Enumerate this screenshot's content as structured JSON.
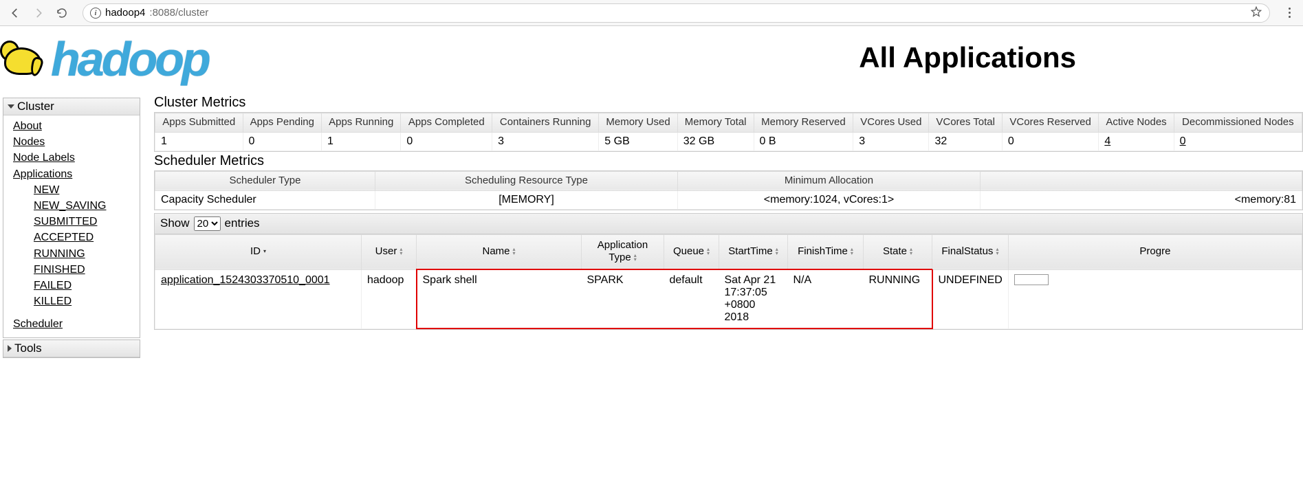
{
  "browser": {
    "url_host": "hadoop4",
    "url_rest": ":8088/cluster"
  },
  "header": {
    "logo_text": "hadoop",
    "page_title": "All Applications"
  },
  "sidebar": {
    "cluster_label": "Cluster",
    "tools_label": "Tools",
    "links": {
      "about": "About",
      "nodes": "Nodes",
      "node_labels": "Node Labels",
      "applications": "Applications",
      "scheduler": "Scheduler"
    },
    "app_states": [
      "NEW",
      "NEW_SAVING",
      "SUBMITTED",
      "ACCEPTED",
      "RUNNING",
      "FINISHED",
      "FAILED",
      "KILLED"
    ]
  },
  "cluster_metrics": {
    "section_title": "Cluster Metrics",
    "headers": [
      "Apps Submitted",
      "Apps Pending",
      "Apps Running",
      "Apps Completed",
      "Containers Running",
      "Memory Used",
      "Memory Total",
      "Memory Reserved",
      "VCores Used",
      "VCores Total",
      "VCores Reserved",
      "Active Nodes",
      "Decommissioned Nodes"
    ],
    "values": [
      "1",
      "0",
      "1",
      "0",
      "3",
      "5 GB",
      "32 GB",
      "0 B",
      "3",
      "32",
      "0",
      "4",
      "0"
    ]
  },
  "scheduler_metrics": {
    "section_title": "Scheduler Metrics",
    "headers": [
      "Scheduler Type",
      "Scheduling Resource Type",
      "Minimum Allocation",
      ""
    ],
    "values": [
      "Capacity Scheduler",
      "[MEMORY]",
      "<memory:1024, vCores:1>",
      "<memory:81"
    ]
  },
  "show_entries": {
    "prefix": "Show",
    "value": "20",
    "suffix": "entries"
  },
  "apps_table": {
    "headers": [
      "ID",
      "User",
      "Name",
      "Application Type",
      "Queue",
      "StartTime",
      "FinishTime",
      "State",
      "FinalStatus",
      "Progre"
    ],
    "rows": [
      {
        "id": "application_1524303370510_0001",
        "user": "hadoop",
        "name": "Spark shell",
        "app_type": "SPARK",
        "queue": "default",
        "start_time": "Sat Apr 21 17:37:05 +0800 2018",
        "finish_time": "N/A",
        "state": "RUNNING",
        "final_status": "UNDEFINED"
      }
    ]
  }
}
